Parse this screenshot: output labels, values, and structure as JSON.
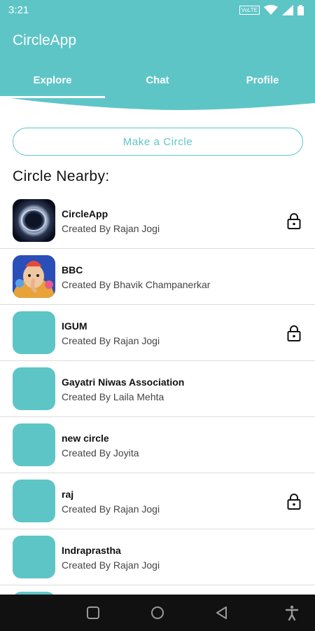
{
  "status_bar": {
    "time": "3:21",
    "volte": "VoLTE"
  },
  "header": {
    "title": "CircleApp"
  },
  "tabs": [
    {
      "label": "Explore",
      "active": true
    },
    {
      "label": "Chat"
    },
    {
      "label": "Profile"
    }
  ],
  "actions": {
    "make_circle_label": "Make a Circle"
  },
  "section": {
    "title": "Circle Nearby:"
  },
  "circles": [
    {
      "name": "CircleApp",
      "creator": "Created By Rajan Jogi",
      "locked": true,
      "avatar": "galaxy-image"
    },
    {
      "name": "BBC",
      "creator": "Created By Bhavik Champanerkar",
      "locked": false,
      "avatar": "ganesha-image"
    },
    {
      "name": "IGUM",
      "creator": "Created By Rajan Jogi",
      "locked": true,
      "avatar": "placeholder"
    },
    {
      "name": "Gayatri Niwas Association",
      "creator": "Created By Laila Mehta",
      "locked": false,
      "avatar": "placeholder"
    },
    {
      "name": "new circle",
      "creator": "Created By Joyita",
      "locked": false,
      "avatar": "placeholder"
    },
    {
      "name": "raj",
      "creator": "Created By Rajan Jogi",
      "locked": true,
      "avatar": "placeholder"
    },
    {
      "name": "Indraprastha",
      "creator": "Created By Rajan Jogi",
      "locked": false,
      "avatar": "placeholder"
    }
  ],
  "colors": {
    "accent": "#5ec5c7",
    "nav_bar": "#111111",
    "divider": "#dcdcdc"
  },
  "nav_bar": {
    "icons": [
      "recents-square-icon",
      "home-circle-icon",
      "back-triangle-icon",
      "accessibility-icon"
    ]
  }
}
